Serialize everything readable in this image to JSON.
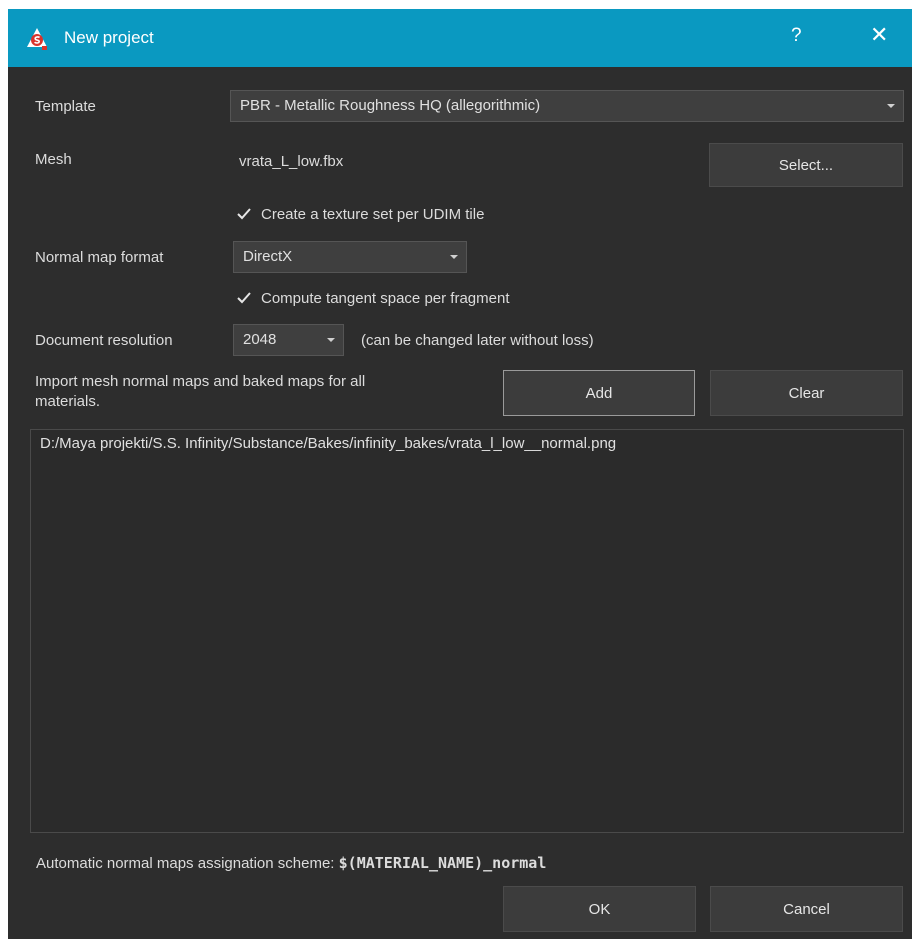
{
  "window": {
    "title": "New project",
    "help_label": "?",
    "close_label": "✕",
    "accent_color": "#0a99c1"
  },
  "form": {
    "template_label": "Template",
    "template_value": "PBR - Metallic Roughness HQ (allegorithmic)",
    "mesh_label": "Mesh",
    "mesh_value": "vrata_L_low.fbx",
    "select_button": "Select...",
    "udim_checkbox_label": "Create a texture set per UDIM tile",
    "udim_checked": true,
    "normal_format_label": "Normal map format",
    "normal_format_value": "DirectX",
    "tangent_checkbox_label": "Compute tangent space per fragment",
    "tangent_checked": true,
    "resolution_label": "Document resolution",
    "resolution_value": "2048",
    "resolution_note": "(can be changed later without loss)",
    "import_label_line1": "Import mesh normal maps and baked maps for all",
    "import_label_line2": "materials.",
    "add_button": "Add",
    "clear_button": "Clear"
  },
  "file_list": {
    "items": [
      "D:/Maya projekti/S.S. Infinity/Substance/Bakes/infinity_bakes/vrata_l_low__normal.png"
    ]
  },
  "scheme": {
    "label": "Automatic normal maps assignation scheme:",
    "value": "$(MATERIAL_NAME)_normal"
  },
  "footer": {
    "ok_button": "OK",
    "cancel_button": "Cancel"
  },
  "icons": {
    "app": "substance-painter-logo-icon",
    "check": "checkmark-icon",
    "dropdown": "triangle-down-icon"
  }
}
